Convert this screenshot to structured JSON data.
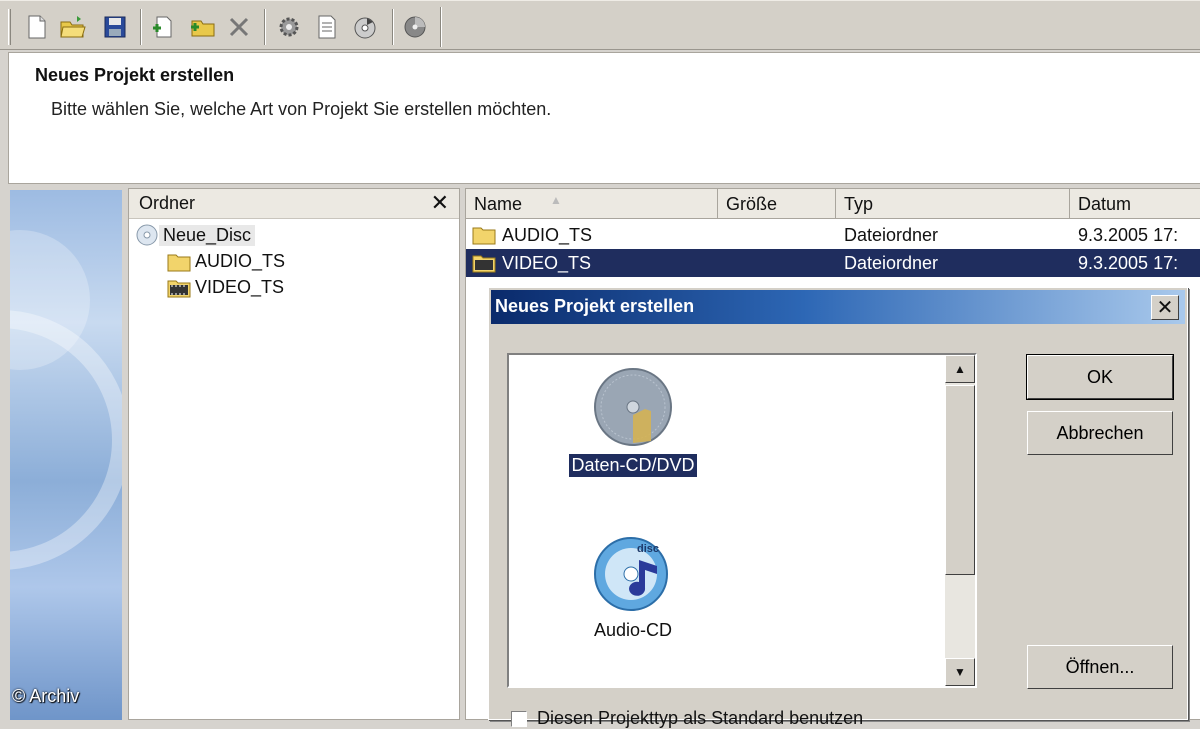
{
  "toolbar": {
    "buttons": [
      {
        "icon": "new-file-icon"
      },
      {
        "icon": "open-folder-icon"
      },
      {
        "icon": "save-icon"
      },
      {
        "icon": "add-files-icon"
      },
      {
        "icon": "add-folder-icon"
      },
      {
        "icon": "delete-icon"
      },
      {
        "icon": "settings-gear-icon"
      },
      {
        "icon": "document-icon"
      },
      {
        "icon": "burn-disc-icon"
      },
      {
        "icon": "disc-icon"
      }
    ]
  },
  "header": {
    "title": "Neues Projekt erstellen",
    "subtitle": "Bitte wählen Sie, welche Art von Projekt Sie erstellen möchten."
  },
  "tree": {
    "title": "Ordner",
    "close_label": "✕",
    "root": "Neue_Disc",
    "children": [
      "AUDIO_TS",
      "VIDEO_TS"
    ]
  },
  "file_list": {
    "columns": [
      "Name",
      "Größe",
      "Typ",
      "Datum"
    ],
    "rows": [
      {
        "name": "AUDIO_TS",
        "size": "",
        "type": "Dateiordner",
        "date": "9.3.2005 17:"
      },
      {
        "name": "VIDEO_TS",
        "size": "",
        "type": "Dateiordner",
        "date": "9.3.2005 17:"
      }
    ],
    "selected_row": "VIDEO_TS"
  },
  "dialog": {
    "title": "Neues Projekt erstellen",
    "close_label": "✕",
    "project_types": [
      {
        "label": "Daten-CD/DVD",
        "icon": "data-disc-icon",
        "selected": true
      },
      {
        "label": "Audio-CD",
        "icon": "audio-disc-icon",
        "selected": false
      }
    ],
    "ok_label": "OK",
    "cancel_label": "Abbrechen",
    "open_label": "Öffnen...",
    "checkbox_label": "Diesen Projekttyp als Standard benutzen",
    "checkbox_checked": false
  },
  "watermark": "© Archiv",
  "colors": {
    "selection": "#1f2d5e",
    "titlebar_start": "#0a2a6b",
    "titlebar_end": "#a9c9ec",
    "chrome": "#d4d0c8"
  }
}
